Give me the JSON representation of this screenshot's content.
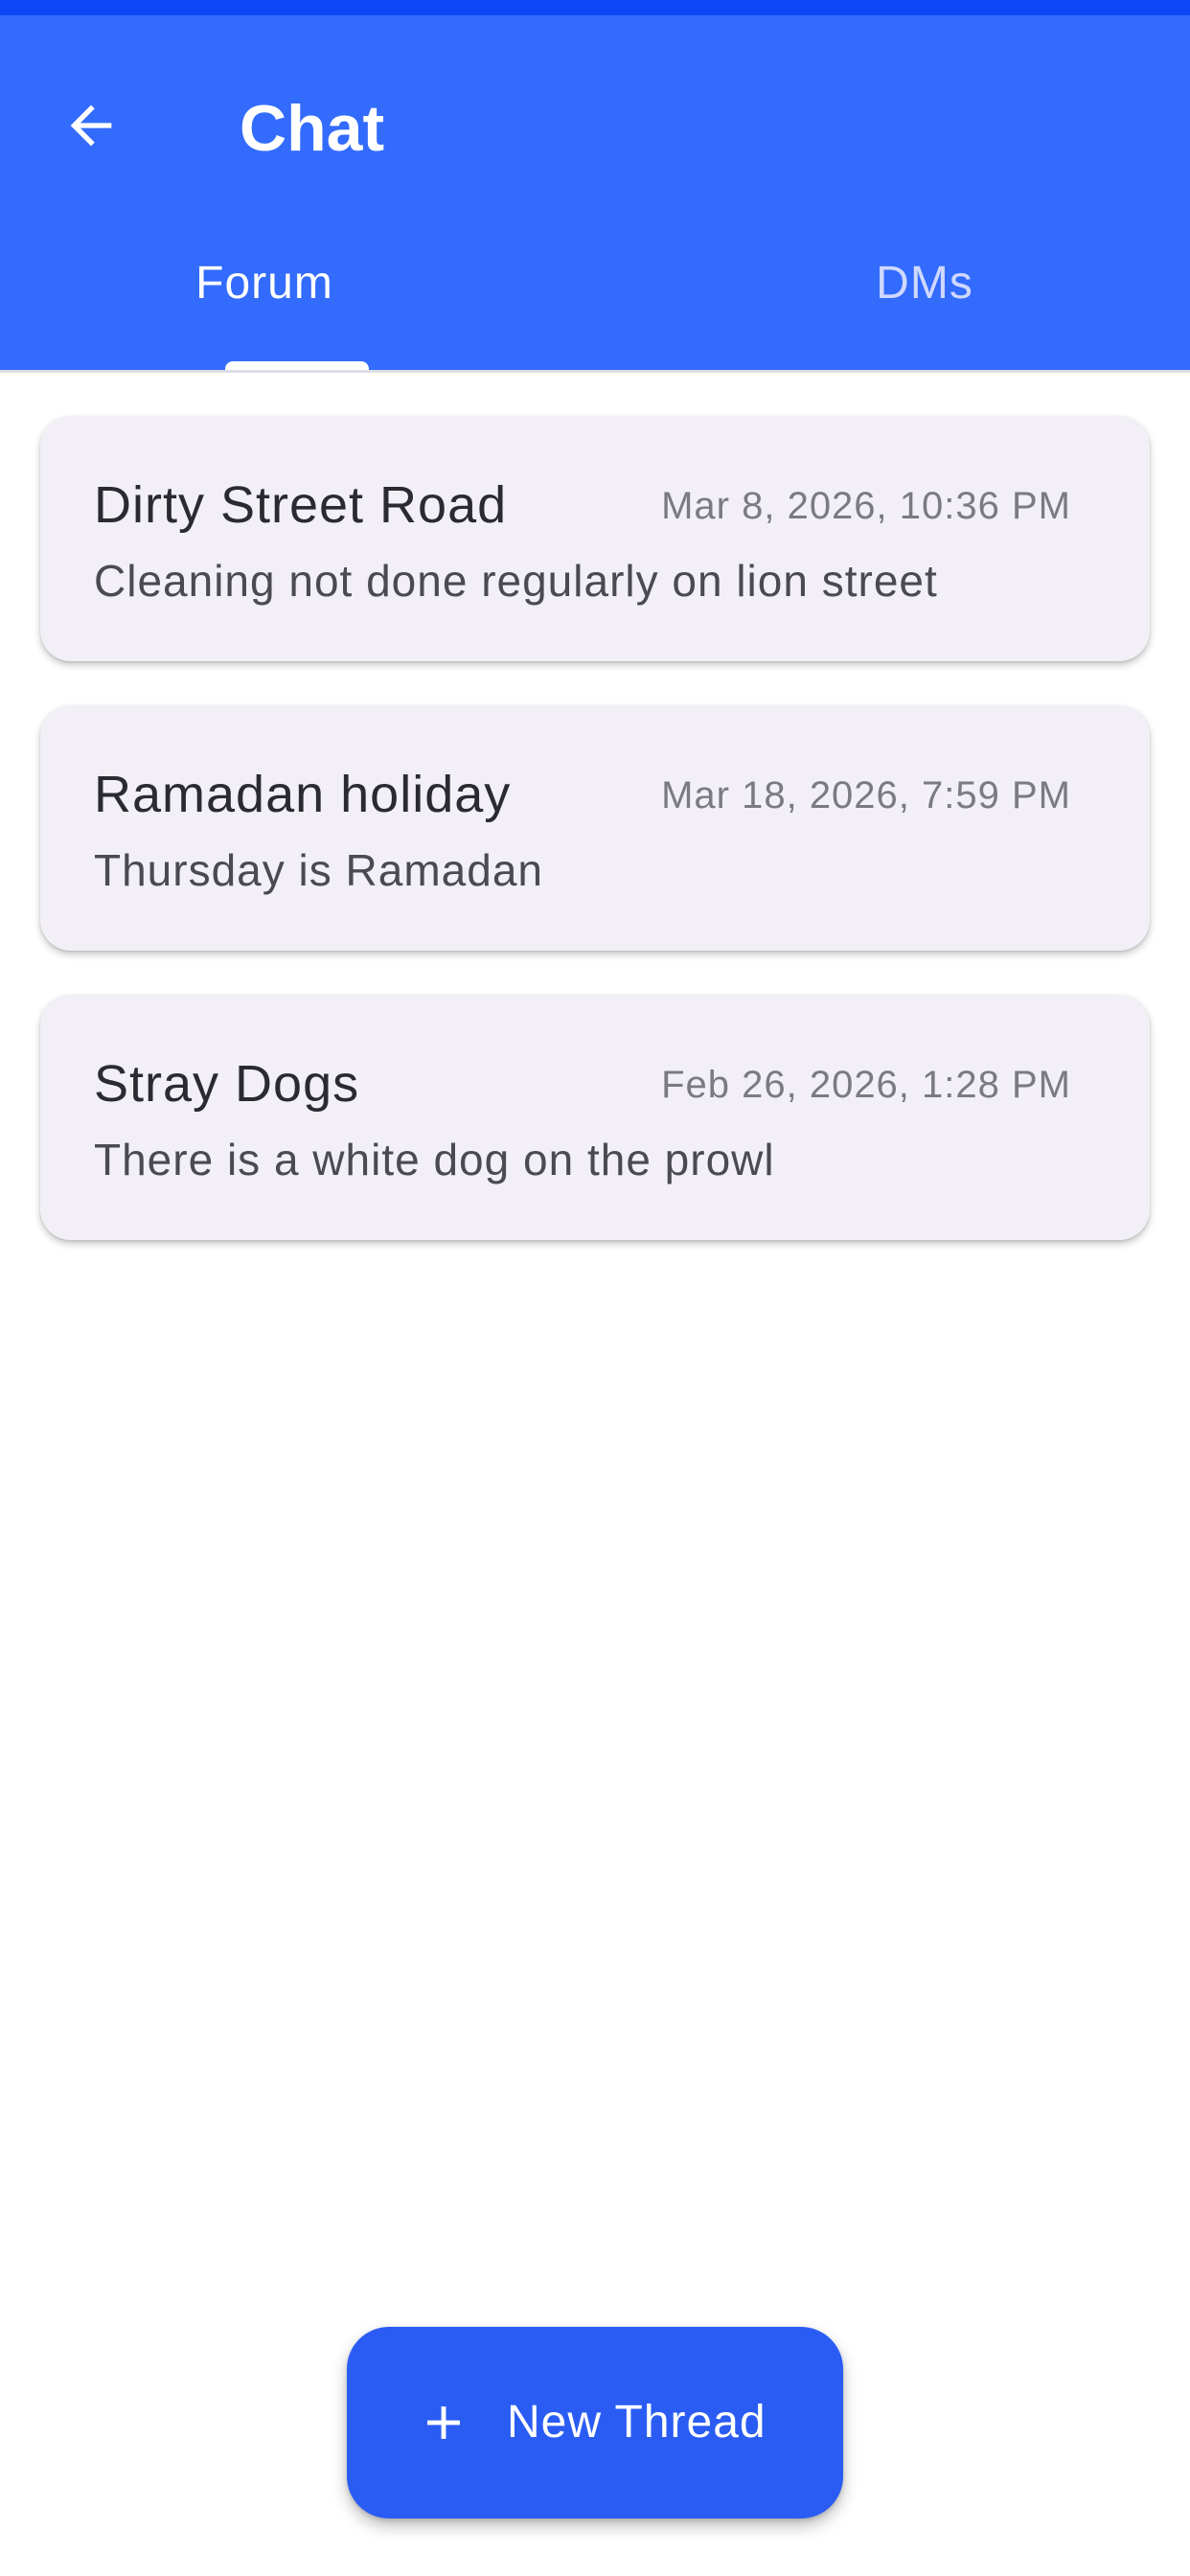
{
  "header": {
    "title": "Chat",
    "back_icon": "arrow-left-icon"
  },
  "tabs": [
    {
      "label": "Forum",
      "selected": true
    },
    {
      "label": "DMs",
      "selected": false
    }
  ],
  "threads": [
    {
      "title": "Dirty Street Road",
      "timestamp": "Mar 8, 2026, 10:36 PM",
      "preview": "Cleaning not done regularly on lion street"
    },
    {
      "title": "Ramadan holiday",
      "timestamp": "Mar 18, 2026, 7:59 PM",
      "preview": "Thursday is Ramadan"
    },
    {
      "title": "Stray Dogs",
      "timestamp": "Feb 26, 2026, 1:28 PM",
      "preview": "There is a white dog on the prowl"
    }
  ],
  "fab": {
    "label": "New Thread",
    "icon": "plus-icon"
  },
  "colors": {
    "app_bar": "#336bfc",
    "status_bar": "#0d47f5",
    "fab": "#2a5cf4",
    "card_background": "#f2f0f6"
  }
}
